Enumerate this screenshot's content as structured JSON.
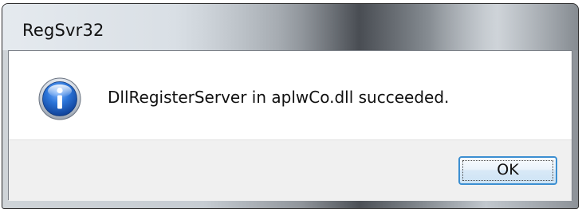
{
  "window": {
    "title": "RegSvr32"
  },
  "dialog": {
    "icon": "information-icon",
    "message": "DllRegisterServer in aplwCo.dll succeeded."
  },
  "buttons": {
    "ok_label": "OK"
  },
  "colors": {
    "icon_blue": "#1f5fbf",
    "button_border": "#3c8fd1",
    "button_bar": "#f0f0f0"
  }
}
